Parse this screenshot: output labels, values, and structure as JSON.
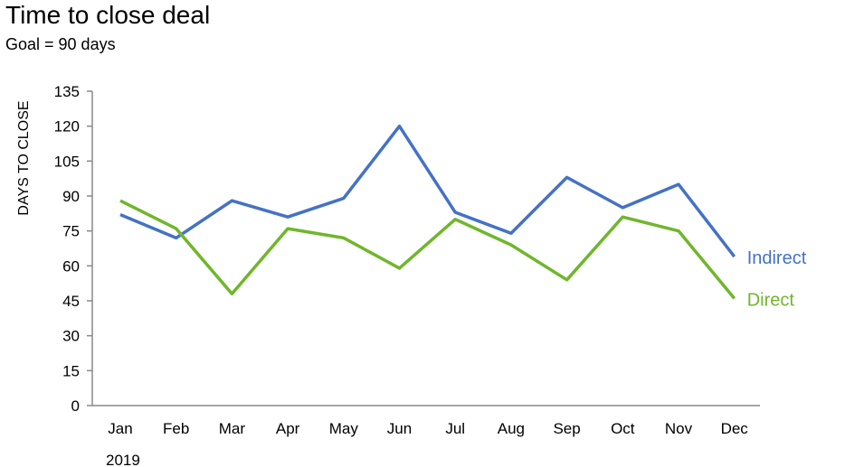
{
  "chart_data": {
    "type": "line",
    "title": "Time to close deal",
    "subtitle": "Goal = 90 days",
    "xlabel": "2019",
    "ylabel": "DAYS TO CLOSE",
    "categories": [
      "Jan",
      "Feb",
      "Mar",
      "Apr",
      "May",
      "Jun",
      "Jul",
      "Aug",
      "Sep",
      "Oct",
      "Nov",
      "Dec"
    ],
    "ylim": [
      0,
      135
    ],
    "yticks": [
      0,
      15,
      30,
      45,
      60,
      75,
      90,
      105,
      120,
      135
    ],
    "grid": false,
    "legend": "direct labels at line ends (right)",
    "series": [
      {
        "name": "Indirect",
        "color": "#4472C4",
        "values": [
          82,
          72,
          88,
          81,
          89,
          120,
          83,
          74,
          98,
          85,
          95,
          64
        ]
      },
      {
        "name": "Direct",
        "color": "#70B62C",
        "values": [
          88,
          76,
          48,
          76,
          72,
          59,
          80,
          69,
          54,
          81,
          75,
          46
        ]
      }
    ]
  }
}
